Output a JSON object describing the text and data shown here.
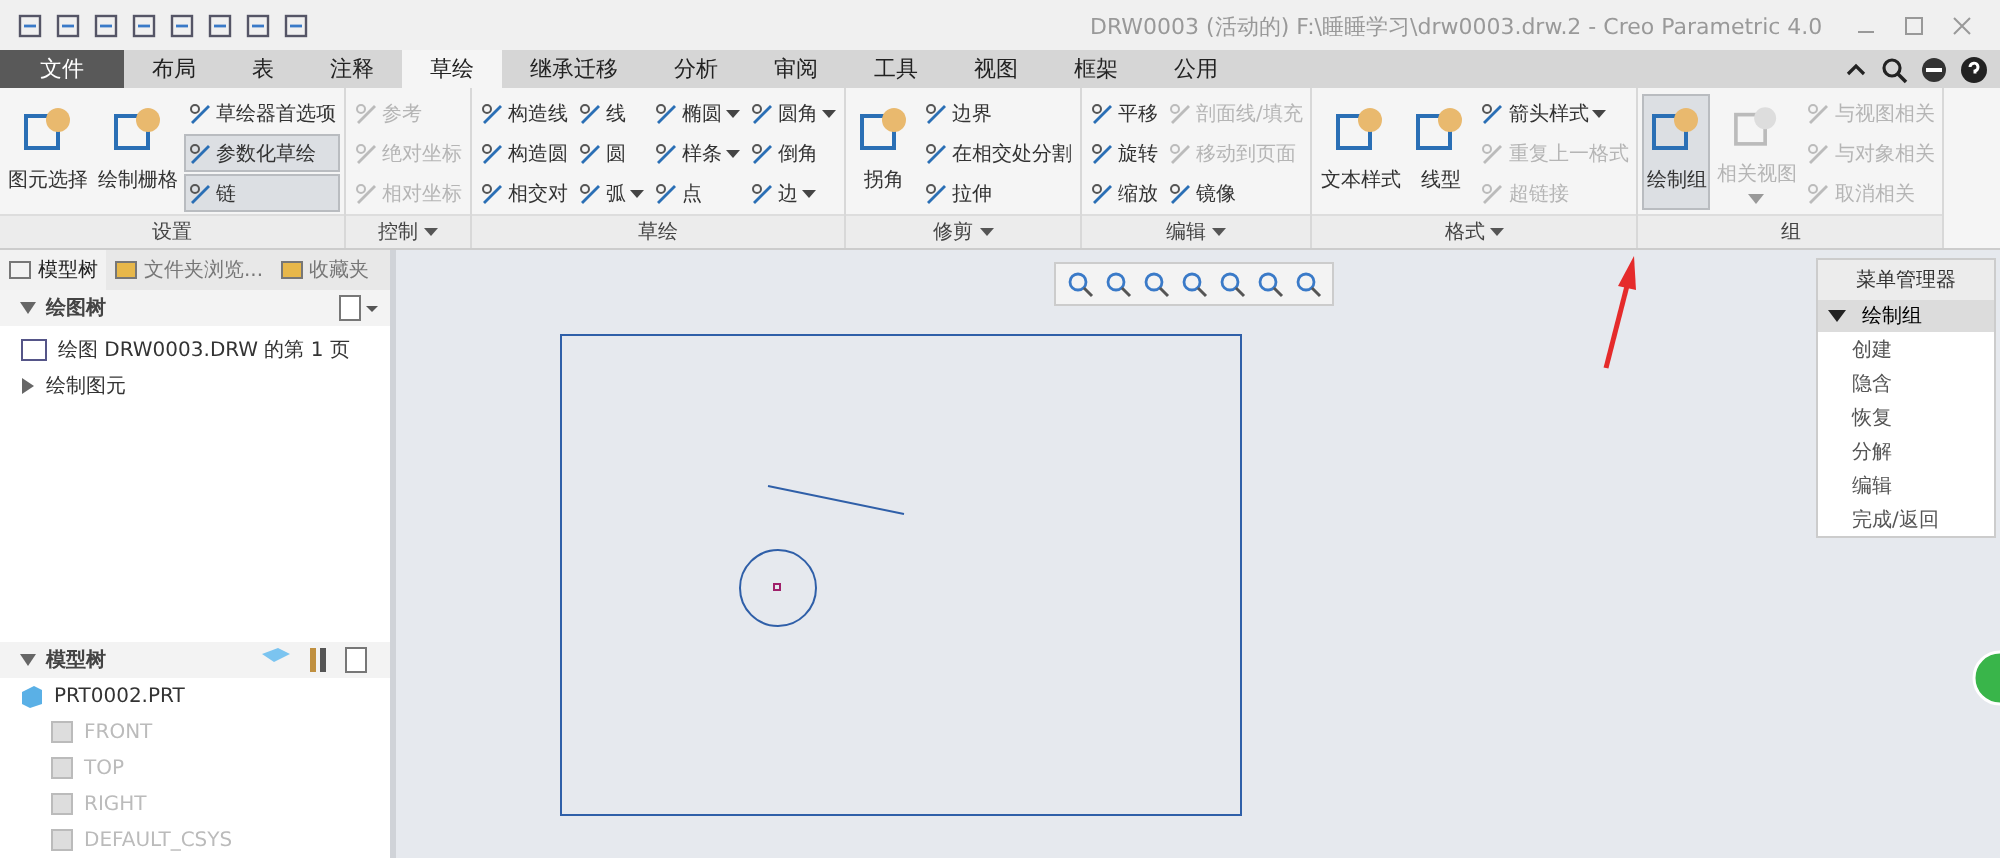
{
  "window": {
    "title": "DRW0003 (活动的) F:\\睡睡学习\\drw0003.drw.2 - Creo Parametric 4.0"
  },
  "tabs": [
    {
      "label": "文件",
      "kind": "file",
      "selected": false
    },
    {
      "label": "布局",
      "kind": "tab",
      "selected": false
    },
    {
      "label": "表",
      "kind": "tab",
      "selected": false
    },
    {
      "label": "注释",
      "kind": "tab",
      "selected": false
    },
    {
      "label": "草绘",
      "kind": "tab",
      "selected": true
    },
    {
      "label": "继承迁移",
      "kind": "tab",
      "selected": false
    },
    {
      "label": "分析",
      "kind": "tab",
      "selected": false
    },
    {
      "label": "审阅",
      "kind": "tab",
      "selected": false
    },
    {
      "label": "工具",
      "kind": "tab",
      "selected": false
    },
    {
      "label": "视图",
      "kind": "tab",
      "selected": false
    },
    {
      "label": "框架",
      "kind": "tab",
      "selected": false
    },
    {
      "label": "公用",
      "kind": "tab",
      "selected": false
    }
  ],
  "ribbon": [
    {
      "label": "设置",
      "menu": false,
      "columns": [
        [
          {
            "label": "图元选择",
            "kind": "large",
            "disabled": false,
            "pressed": false,
            "dropdown": false
          }
        ],
        [
          {
            "label": "绘制栅格",
            "kind": "large",
            "disabled": false,
            "pressed": false,
            "dropdown": false
          }
        ],
        [
          {
            "label": "草绘器首选项",
            "kind": "small",
            "disabled": false,
            "pressed": false,
            "dropdown": false
          },
          {
            "label": "参数化草绘",
            "kind": "small",
            "disabled": false,
            "pressed": true,
            "dropdown": false
          },
          {
            "label": "链",
            "kind": "small",
            "disabled": false,
            "pressed": true,
            "dropdown": false
          }
        ]
      ]
    },
    {
      "label": "控制",
      "menu": true,
      "columns": [
        [
          {
            "label": "参考",
            "kind": "small",
            "disabled": true,
            "pressed": false,
            "dropdown": false
          },
          {
            "label": "绝对坐标",
            "kind": "small",
            "disabled": true,
            "pressed": false,
            "dropdown": false
          },
          {
            "label": "相对坐标",
            "kind": "small",
            "disabled": true,
            "pressed": false,
            "dropdown": false
          }
        ]
      ]
    },
    {
      "label": "草绘",
      "menu": false,
      "columns": [
        [
          {
            "label": "构造线",
            "kind": "small",
            "disabled": false,
            "pressed": false,
            "dropdown": false
          },
          {
            "label": "构造圆",
            "kind": "small",
            "disabled": false,
            "pressed": false,
            "dropdown": false
          },
          {
            "label": "相交对",
            "kind": "small",
            "disabled": false,
            "pressed": false,
            "dropdown": false
          }
        ],
        [
          {
            "label": "线",
            "kind": "small",
            "disabled": false,
            "pressed": false,
            "dropdown": false
          },
          {
            "label": "圆",
            "kind": "small",
            "disabled": false,
            "pressed": false,
            "dropdown": false
          },
          {
            "label": "弧",
            "kind": "small",
            "disabled": false,
            "pressed": false,
            "dropdown": true
          }
        ],
        [
          {
            "label": "椭圆",
            "kind": "small",
            "disabled": false,
            "pressed": false,
            "dropdown": true
          },
          {
            "label": "样条",
            "kind": "small",
            "disabled": false,
            "pressed": false,
            "dropdown": true
          },
          {
            "label": "点",
            "kind": "small",
            "disabled": false,
            "pressed": false,
            "dropdown": false
          }
        ],
        [
          {
            "label": "圆角",
            "kind": "small",
            "disabled": false,
            "pressed": false,
            "dropdown": true
          },
          {
            "label": "倒角",
            "kind": "small",
            "disabled": false,
            "pressed": false,
            "dropdown": false
          },
          {
            "label": "边",
            "kind": "small",
            "disabled": false,
            "pressed": false,
            "dropdown": true
          }
        ]
      ]
    },
    {
      "label": "修剪",
      "menu": true,
      "columns": [
        [
          {
            "label": "拐角",
            "kind": "large",
            "disabled": false,
            "pressed": false,
            "dropdown": false
          }
        ],
        [
          {
            "label": "边界",
            "kind": "small",
            "disabled": false,
            "pressed": false,
            "dropdown": false
          },
          {
            "label": "在相交处分割",
            "kind": "small",
            "disabled": false,
            "pressed": false,
            "dropdown": false
          },
          {
            "label": "拉伸",
            "kind": "small",
            "disabled": false,
            "pressed": false,
            "dropdown": false
          }
        ]
      ]
    },
    {
      "label": "编辑",
      "menu": true,
      "columns": [
        [
          {
            "label": "平移",
            "kind": "small",
            "disabled": false,
            "pressed": false,
            "dropdown": false
          },
          {
            "label": "旋转",
            "kind": "small",
            "disabled": false,
            "pressed": false,
            "dropdown": false
          },
          {
            "label": "缩放",
            "kind": "small",
            "disabled": false,
            "pressed": false,
            "dropdown": false
          }
        ],
        [
          {
            "label": "剖面线/填充",
            "kind": "small",
            "disabled": true,
            "pressed": false,
            "dropdown": false
          },
          {
            "label": "移动到页面",
            "kind": "small",
            "disabled": true,
            "pressed": false,
            "dropdown": false
          },
          {
            "label": "镜像",
            "kind": "small",
            "disabled": false,
            "pressed": false,
            "dropdown": false
          }
        ]
      ]
    },
    {
      "label": "格式",
      "menu": true,
      "columns": [
        [
          {
            "label": "文本样式",
            "kind": "large",
            "disabled": false,
            "pressed": false,
            "dropdown": false
          }
        ],
        [
          {
            "label": "线型",
            "kind": "large",
            "disabled": false,
            "pressed": false,
            "dropdown": false
          }
        ],
        [
          {
            "label": "箭头样式",
            "kind": "small",
            "disabled": false,
            "pressed": false,
            "dropdown": true
          },
          {
            "label": "重复上一格式",
            "kind": "small",
            "disabled": true,
            "pressed": false,
            "dropdown": false
          },
          {
            "label": "超链接",
            "kind": "small",
            "disabled": true,
            "pressed": false,
            "dropdown": false
          }
        ]
      ]
    },
    {
      "label": "组",
      "menu": false,
      "columns": [
        [
          {
            "label": "绘制组",
            "kind": "large",
            "disabled": false,
            "pressed": true,
            "dropdown": false
          }
        ],
        [
          {
            "label": "相关视图",
            "kind": "large",
            "disabled": true,
            "pressed": false,
            "dropdown": true
          }
        ],
        [
          {
            "label": "与视图相关",
            "kind": "small",
            "disabled": true,
            "pressed": false,
            "dropdown": false
          },
          {
            "label": "与对象相关",
            "kind": "small",
            "disabled": true,
            "pressed": false,
            "dropdown": false
          },
          {
            "label": "取消相关",
            "kind": "small",
            "disabled": true,
            "pressed": false,
            "dropdown": false
          }
        ]
      ]
    }
  ],
  "panel_tabs": [
    {
      "label": "模型树",
      "selected": true
    },
    {
      "label": "文件夹浏览...",
      "selected": false
    },
    {
      "label": "收藏夹",
      "selected": false
    }
  ],
  "drawing_tree": {
    "title": "绘图树",
    "items": [
      {
        "label": "绘图 DRW0003.DRW 的第 1 页",
        "expandable": false,
        "dimmed": false
      },
      {
        "label": "绘制图元",
        "expandable": true,
        "dimmed": false
      }
    ]
  },
  "model_tree": {
    "title": "模型树",
    "items": [
      {
        "label": "PRT0002.PRT",
        "dimmed": false,
        "children": [
          {
            "label": "FRONT",
            "dimmed": true
          },
          {
            "label": "TOP",
            "dimmed": true
          },
          {
            "label": "RIGHT",
            "dimmed": true
          },
          {
            "label": "DEFAULT_CSYS",
            "dimmed": true
          }
        ]
      }
    ]
  },
  "menu_manager": {
    "title": "菜单管理器",
    "group": "绘制组",
    "expanded": true,
    "items": [
      "创建",
      "隐含",
      "恢复",
      "分解",
      "编辑",
      "完成/返回"
    ]
  }
}
